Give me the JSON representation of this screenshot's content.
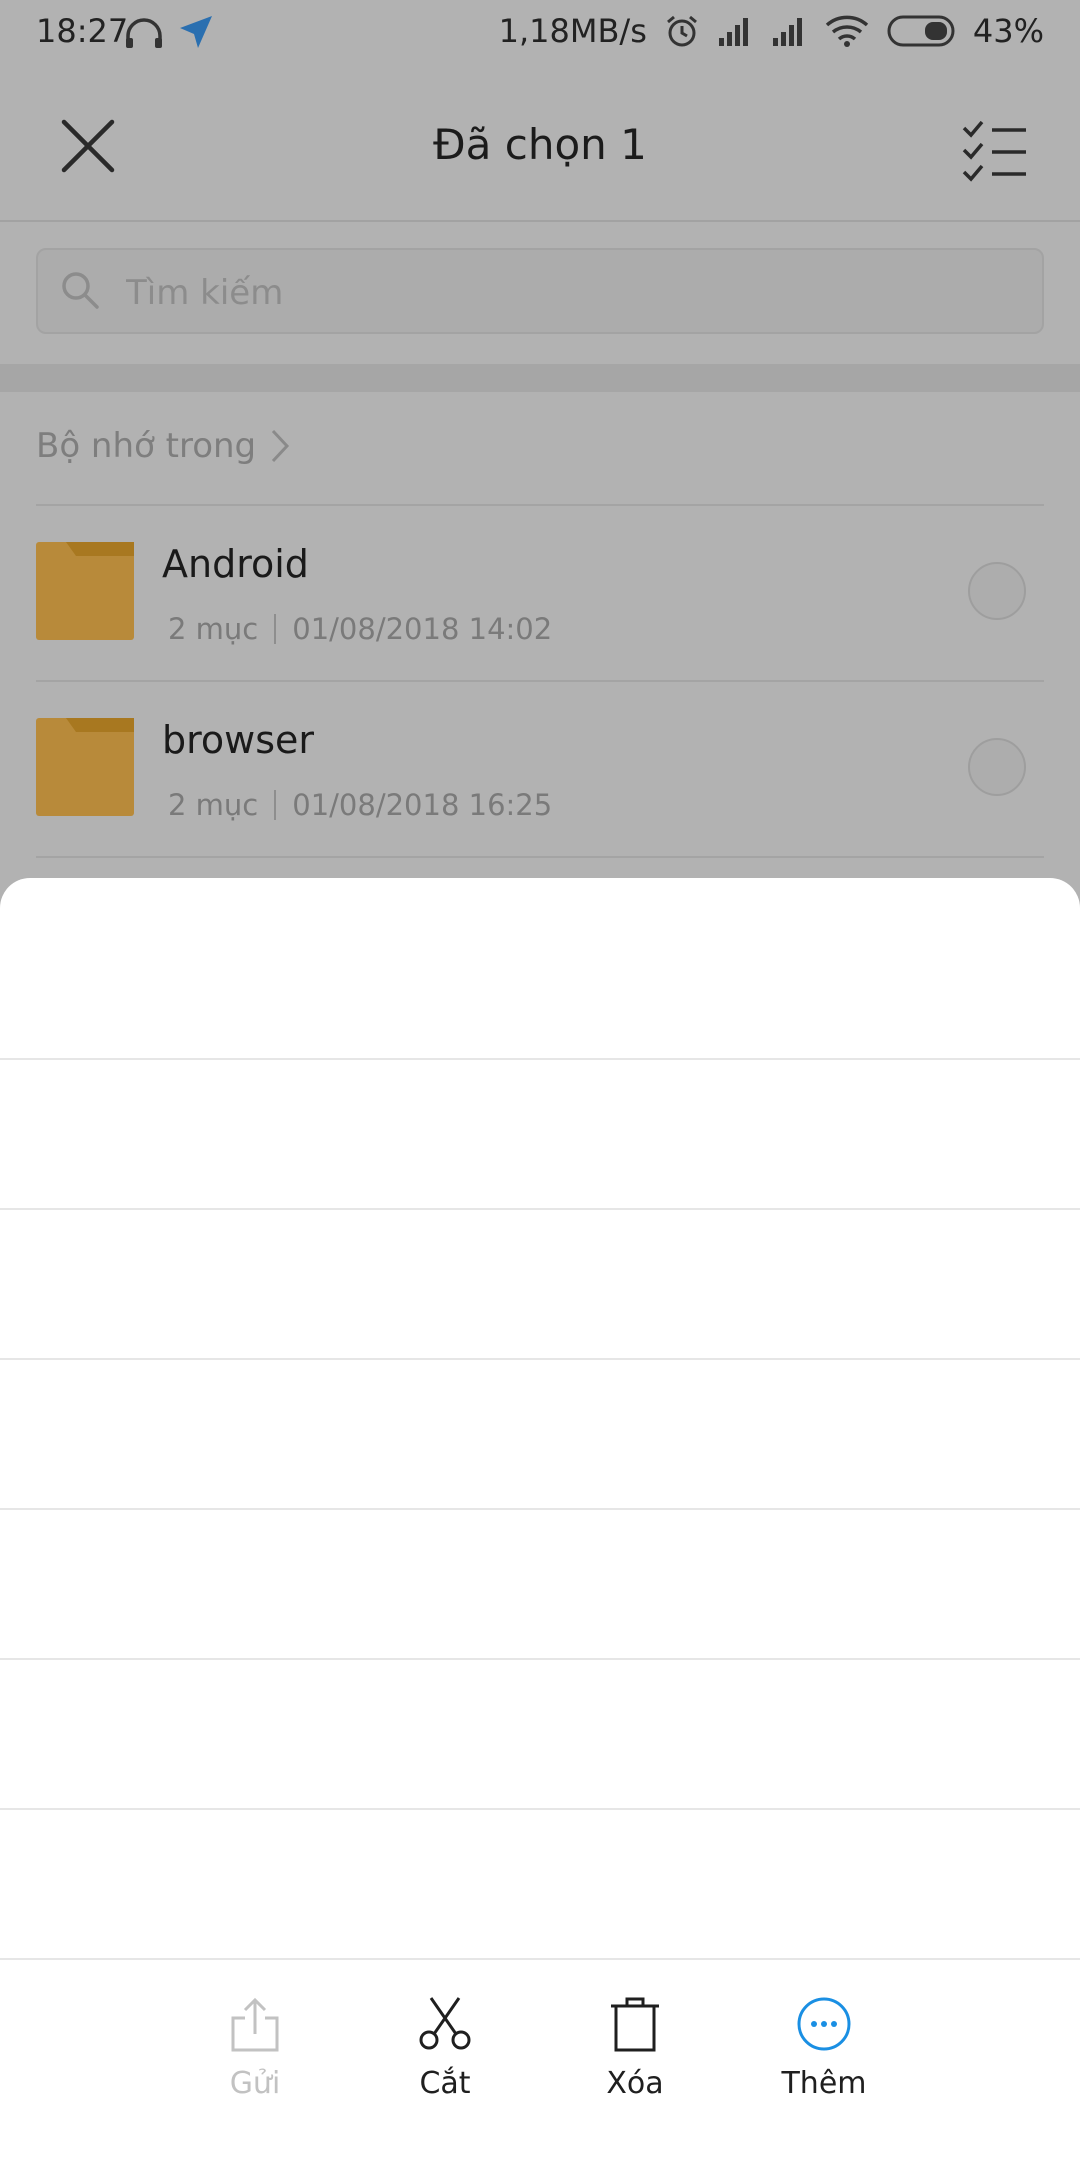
{
  "status_bar": {
    "time": "18:27",
    "speed": "1,18MB/s",
    "battery": "43%"
  },
  "header": {
    "title": "Đã chọn 1"
  },
  "search": {
    "placeholder": "Tìm kiếm"
  },
  "breadcrumb": {
    "label": "Bộ nhớ trong"
  },
  "files": [
    {
      "name": "Android",
      "count": "2 mục",
      "date": "01/08/2018 14:02"
    },
    {
      "name": "browser",
      "count": "2 mục",
      "date": "01/08/2018 16:25"
    }
  ],
  "toolbar": {
    "send": "Gửi",
    "cut": "Cắt",
    "delete": "Xóa",
    "more": "Thêm"
  },
  "colors": {
    "accent": "#1a8fe3",
    "folder": "#b88a3a",
    "disabled": "#c2c2c2"
  }
}
